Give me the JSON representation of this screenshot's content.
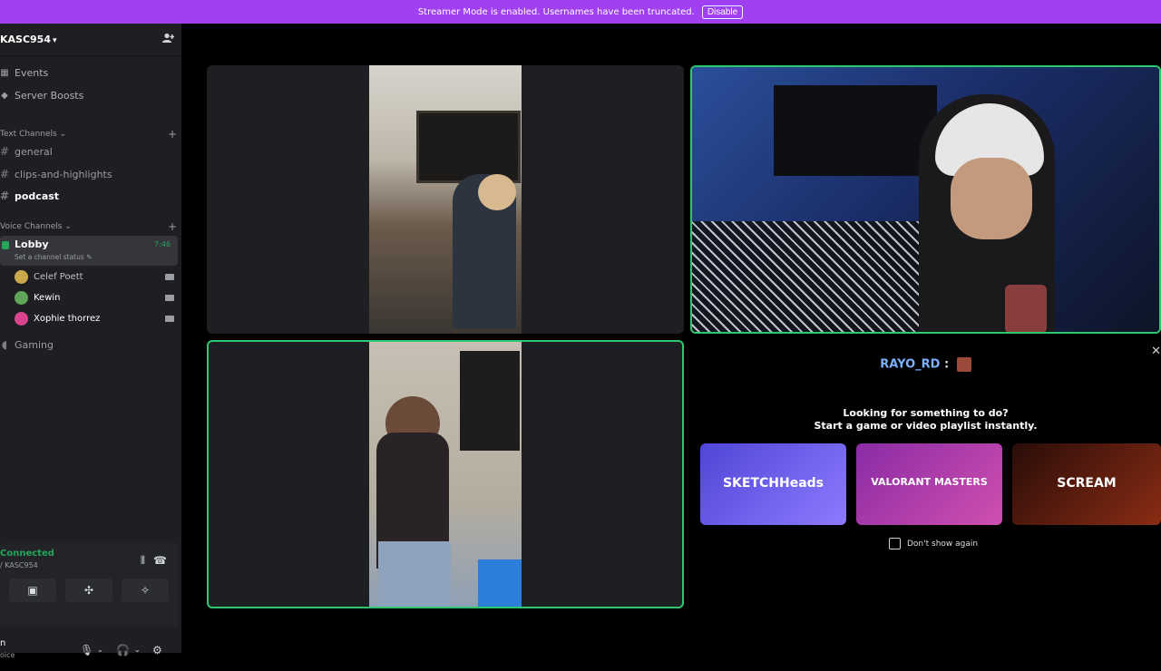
{
  "banner": {
    "text": "Streamer Mode is enabled. Usernames have been truncated.",
    "button": "Disable"
  },
  "server": {
    "name": "KASC954",
    "chevron": "⌄",
    "invite_icon": "person-add-icon"
  },
  "nav": [
    {
      "label": "Events",
      "icon": "calendar-icon"
    },
    {
      "label": "Server Boosts",
      "icon": "boost-icon"
    }
  ],
  "text_channels": {
    "category": "Text Channels",
    "channels": [
      "general",
      "clips-and-highlights",
      "podcast"
    ]
  },
  "voice_channels": {
    "category": "Voice Channels",
    "lobby": {
      "name": "Lobby",
      "time": "7:46",
      "status": "Set a channel status"
    },
    "members": [
      {
        "name": "Celef Poett",
        "color": "#c9a94c"
      },
      {
        "name": "Kewin",
        "color": "#5fa55a"
      },
      {
        "name": "Xophie thorrez",
        "color": "#d9438f"
      }
    ],
    "other": "Gaming"
  },
  "voice_panel": {
    "status": "Connected",
    "sub": "/ KASC954"
  },
  "user_panel": {
    "name": "n",
    "sub": "oice"
  },
  "activity": {
    "username": "RAYO_RD",
    "colon": ":",
    "title_line1": "Looking for something to do?",
    "title_line2": "Start a game or video playlist instantly.",
    "cards": [
      {
        "label": "SKETCHHeads",
        "color": "#6b58e8"
      },
      {
        "label": "VALORANT MASTERS",
        "color": "#b33ab4"
      },
      {
        "label": "SCREAM",
        "color": "#7a1e12"
      }
    ],
    "dont_show": "Don't show again"
  },
  "colors": {
    "accent": "#a140f0",
    "speaking": "#2dc770",
    "connected": "#23a55a"
  }
}
